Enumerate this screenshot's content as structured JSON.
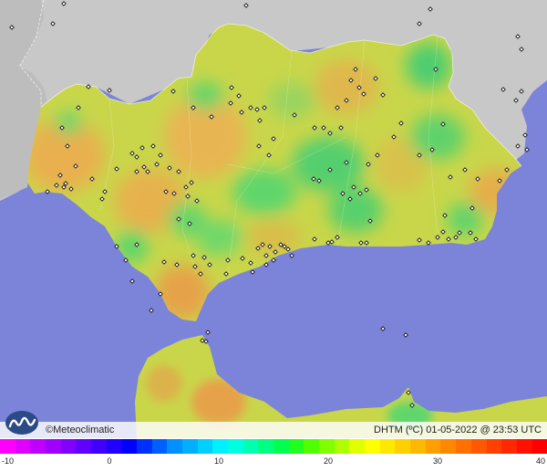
{
  "map": {
    "credit": "©Meteoclimatic",
    "variable": "DHTM",
    "unit": "(ºC)",
    "date": "01-05-2022",
    "at": "@",
    "time": "23:53 UTC",
    "colors": {
      "sea": "#7b84d9",
      "land_outside": "#c9c9c9",
      "region_fill": "#c9d64a",
      "hot": "#e9a34a",
      "cool": "#52cf6a",
      "station_marker": "#ffffff"
    },
    "station_icon": "diamond-marker",
    "logo_icon": "meteoclimatic-logo-icon"
  },
  "legend": {
    "min": -10,
    "max": 40,
    "ticks": [
      "-10",
      "0",
      "10",
      "20",
      "30",
      "40"
    ],
    "tick_values": [
      -10,
      0,
      10,
      20,
      30,
      40
    ],
    "colors": [
      "#ff00ff",
      "#e000ff",
      "#c000ff",
      "#a000ff",
      "#8000ff",
      "#6000ff",
      "#4000ff",
      "#2000ff",
      "#0000ff",
      "#0030ff",
      "#0060ff",
      "#0090ff",
      "#00b0ff",
      "#00d0ff",
      "#00f0ff",
      "#00ffe0",
      "#00ffb0",
      "#00ff80",
      "#00ff50",
      "#20ff20",
      "#50ff00",
      "#80ff00",
      "#b0ff00",
      "#e0ff00",
      "#ffff00",
      "#ffe800",
      "#ffd000",
      "#ffb800",
      "#ffa000",
      "#ff8800",
      "#ff7000",
      "#ff5800",
      "#ff4000",
      "#ff2800",
      "#ff1000",
      "#ff0000"
    ]
  }
}
